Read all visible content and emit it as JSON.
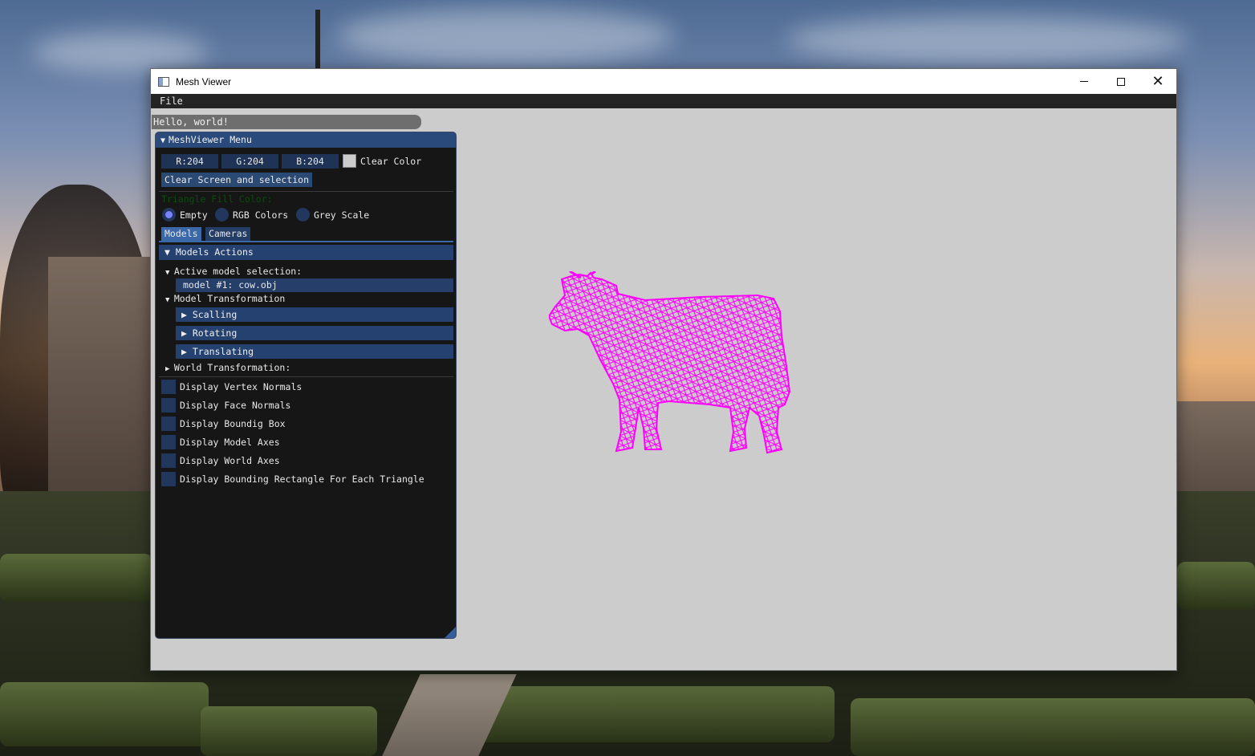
{
  "window": {
    "title": "Mesh Viewer",
    "icon": "app-window-icon",
    "controls": {
      "minimize": "minimize-icon",
      "maximize": "maximize-icon",
      "close": "✕"
    }
  },
  "menubar": {
    "items": [
      "File"
    ]
  },
  "hello_window": {
    "title": "Hello, world!"
  },
  "panel": {
    "title": "MeshViewer Menu",
    "clear_color": {
      "r": "R:204",
      "g": "G:204",
      "b": "B:204",
      "label": "Clear Color",
      "swatch": "#cccccc"
    },
    "clear_button": "Clear Screen and selection",
    "fill_color_label": "Triangle Fill Color:",
    "fill_options": [
      {
        "label": "Empty",
        "selected": true
      },
      {
        "label": "RGB Colors",
        "selected": false
      },
      {
        "label": "Grey Scale",
        "selected": false
      }
    ],
    "tabs": [
      {
        "label": "Models",
        "active": true
      },
      {
        "label": "Cameras",
        "active": false
      }
    ],
    "models_actions": {
      "header": "Models Actions",
      "active_model_label": "Active model selection:",
      "active_model": "model #1: cow.obj",
      "model_transformation": "Model Transformation",
      "transformations": [
        "Scalling",
        "Rotating",
        "Translating"
      ],
      "world_transformation": "World Transformation:"
    },
    "checkboxes": [
      {
        "label": "Display Vertex Normals",
        "checked": false
      },
      {
        "label": "Display Face Normals",
        "checked": false
      },
      {
        "label": "Display Boundig Box",
        "checked": false
      },
      {
        "label": "Display Model Axes",
        "checked": false
      },
      {
        "label": "Display World Axes",
        "checked": false
      },
      {
        "label": "Display Bounding Rectangle For Each Triangle",
        "checked": false
      }
    ]
  },
  "viewport": {
    "background": "#cccccc",
    "model_color": "#ff00ff",
    "model_name": "cow.obj"
  }
}
